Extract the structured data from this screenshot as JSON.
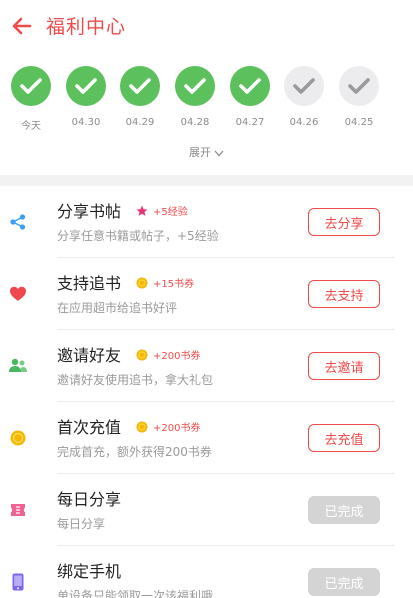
{
  "header": {
    "title": "福利中心",
    "back_icon": "arrow-left-icon",
    "accent": "#ee4b4b"
  },
  "checkin": {
    "days": [
      {
        "label": "今天",
        "checked": true
      },
      {
        "label": "04.30",
        "checked": true
      },
      {
        "label": "04.29",
        "checked": true
      },
      {
        "label": "04.28",
        "checked": true
      },
      {
        "label": "04.27",
        "checked": true
      },
      {
        "label": "04.26",
        "checked": false
      },
      {
        "label": "04.25",
        "checked": false
      }
    ],
    "done_color": "#5cc05c",
    "todo_color": "#ececee",
    "expand_label": "展开"
  },
  "tasks": [
    {
      "title": "分享书帖",
      "reward": "+5经验",
      "reward_icon": "star-icon",
      "desc": "分享任意书籍或帖子，+5经验",
      "button": "去分享",
      "status": "available",
      "icon": "share-icon",
      "icon_color": "#3a9ff5"
    },
    {
      "title": "支持追书",
      "reward": "+15书券",
      "reward_icon": "coin-icon",
      "desc": "在应用超市给追书好评",
      "button": "去支持",
      "status": "available",
      "icon": "heart-icon",
      "icon_color": "#f0474f"
    },
    {
      "title": "邀请好友",
      "reward": "+200书券",
      "reward_icon": "coin-icon",
      "desc": "邀请好友使用追书，拿大礼包",
      "button": "去邀请",
      "status": "available",
      "icon": "friends-icon",
      "icon_color": "#4bb861"
    },
    {
      "title": "首次充值",
      "reward": "+200书券",
      "reward_icon": "coin-icon",
      "desc": "完成首充，额外获得200书券",
      "button": "去充值",
      "status": "available",
      "icon": "coin-icon",
      "icon_color": "#f5b800"
    },
    {
      "title": "每日分享",
      "reward": "",
      "desc": "每日分享",
      "button": "已完成",
      "status": "completed",
      "icon": "ticket-icon",
      "icon_color": "#f06292"
    },
    {
      "title": "绑定手机",
      "reward": "",
      "desc": "单设备只能领取一次该福利哦",
      "button": "已完成",
      "status": "completed",
      "icon": "phone-icon",
      "icon_color": "#7b68ee"
    }
  ]
}
